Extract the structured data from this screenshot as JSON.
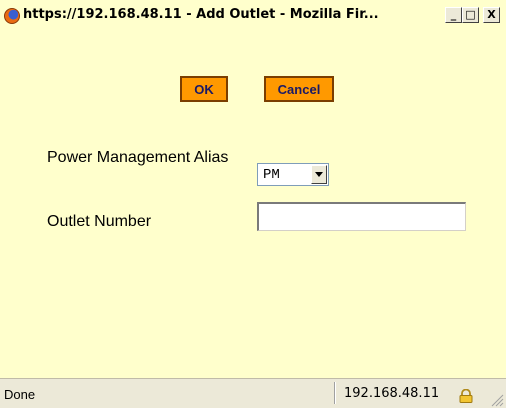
{
  "window": {
    "title": "https://192.168.48.11 - Add Outlet - Mozilla Fir...",
    "controls": {
      "minimize_icon": "minimize-icon",
      "maximize_icon": "maximize-icon",
      "close_icon": "close-icon",
      "minimize_glyph": "_",
      "maximize_glyph": "□",
      "close_glyph": "X"
    },
    "app_icon": "firefox-icon"
  },
  "actions": {
    "ok_label": "OK",
    "cancel_label": "Cancel",
    "button_color": "#ff9900"
  },
  "form": {
    "power_management_alias": {
      "label": "Power Management Alias",
      "selected_value": "PM"
    },
    "outlet_number": {
      "label": "Outlet Number",
      "value": ""
    }
  },
  "statusbar": {
    "status": "Done",
    "host": "192.168.48.11",
    "secure_icon": "lock-icon"
  },
  "colors": {
    "page_background": "#ffffcc",
    "statusbar_background": "#ece9d8"
  }
}
